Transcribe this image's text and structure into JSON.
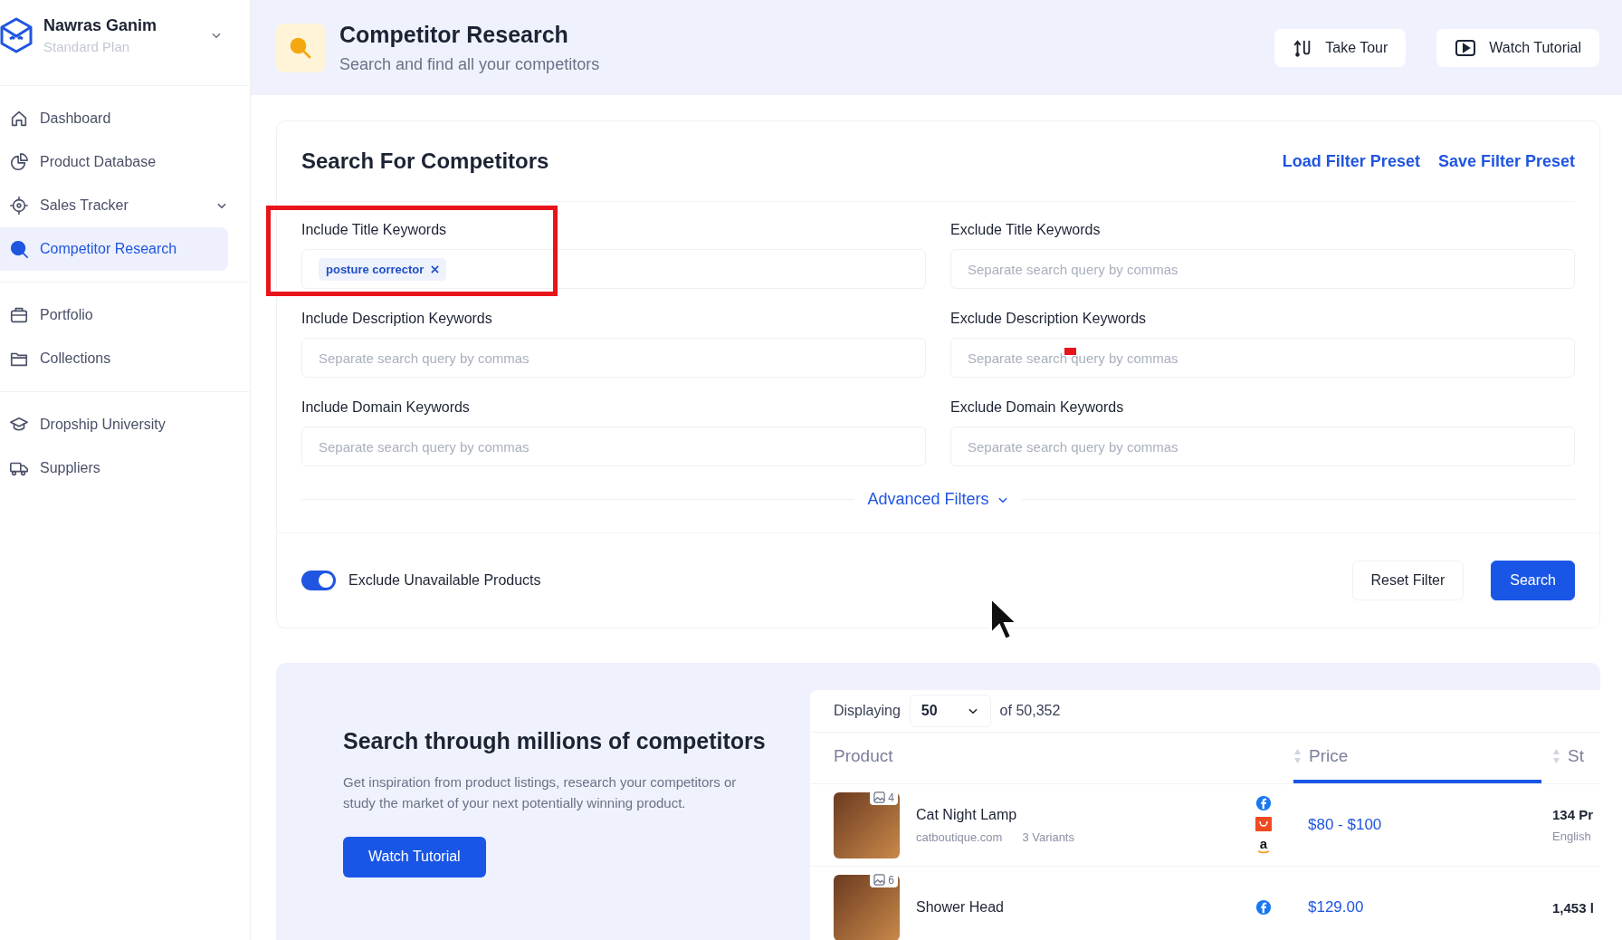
{
  "account": {
    "name": "Nawras Ganim",
    "plan": "Standard Plan"
  },
  "sidebar": {
    "sections": [
      {
        "items": [
          {
            "label": "Dashboard",
            "selected": false,
            "expandable": false
          },
          {
            "label": "Product Database",
            "selected": false,
            "expandable": false
          },
          {
            "label": "Sales Tracker",
            "selected": false,
            "expandable": true
          },
          {
            "label": "Competitor Research",
            "selected": true,
            "expandable": false
          }
        ]
      },
      {
        "items": [
          {
            "label": "Portfolio",
            "selected": false,
            "expandable": false
          },
          {
            "label": "Collections",
            "selected": false,
            "expandable": false
          }
        ]
      },
      {
        "items": [
          {
            "label": "Dropship University",
            "selected": false,
            "expandable": false
          },
          {
            "label": "Suppliers",
            "selected": false,
            "expandable": false
          }
        ]
      }
    ]
  },
  "header": {
    "title": "Competitor Research",
    "subtitle": "Search and find all your competitors",
    "buttons": [
      {
        "label": "Take Tour"
      },
      {
        "label": "Watch Tutorial"
      }
    ]
  },
  "search": {
    "title": "Search For Competitors",
    "links": [
      "Load Filter Preset",
      "Save Filter Preset"
    ],
    "fields": [
      {
        "label": "Include Title Keywords",
        "tags": [
          "posture corrector"
        ]
      },
      {
        "label": "Exclude Title Keywords",
        "placeholder": "Separate search query by commas"
      },
      {
        "label": "Include Description Keywords",
        "placeholder": "Separate search query by commas"
      },
      {
        "label": "Exclude Description Keywords",
        "placeholder": "Separate search query by commas"
      },
      {
        "label": "Include Domain Keywords",
        "placeholder": "Separate search query by commas"
      },
      {
        "label": "Exclude Domain Keywords",
        "placeholder": "Separate search query by commas"
      }
    ],
    "advanced_filters": "Advanced Filters",
    "toggle": {
      "label": "Exclude Unavailable Products",
      "on": true
    },
    "buttons": [
      {
        "label": "Reset Filter",
        "kind": "secondary"
      },
      {
        "label": "Search",
        "kind": "primary"
      }
    ]
  },
  "promo": {
    "title": "Search through millions of competitors",
    "text": "Get inspiration from product listings, research your competitors or study the market of your next potentially winning product.",
    "button": "Watch Tutorial"
  },
  "table": {
    "displaying": "Displaying",
    "page_size": "50",
    "total": "of 50,352",
    "columns": [
      {
        "label": "Product",
        "sortable": false,
        "selected": false
      },
      {
        "label": "Price",
        "sortable": true,
        "selected": true
      },
      {
        "label": "St",
        "sortable": true,
        "selected": false
      }
    ],
    "rows": [
      {
        "name": "Cat Night Lamp",
        "domain": "catboutique.com",
        "variants": "3 Variants",
        "image_count": "4",
        "sources": [
          {
            "kind": "f"
          },
          {
            "kind": "bag"
          },
          {
            "kind": "a"
          }
        ],
        "price": "$80 - $100",
        "column_3": "134 Pr",
        "column_3_sub": "English"
      },
      {
        "name": "Shower Head",
        "image_count": "6",
        "sources": [
          {
            "kind": "f"
          }
        ],
        "price": "$129.00",
        "column_3": "1,453 l"
      }
    ]
  }
}
